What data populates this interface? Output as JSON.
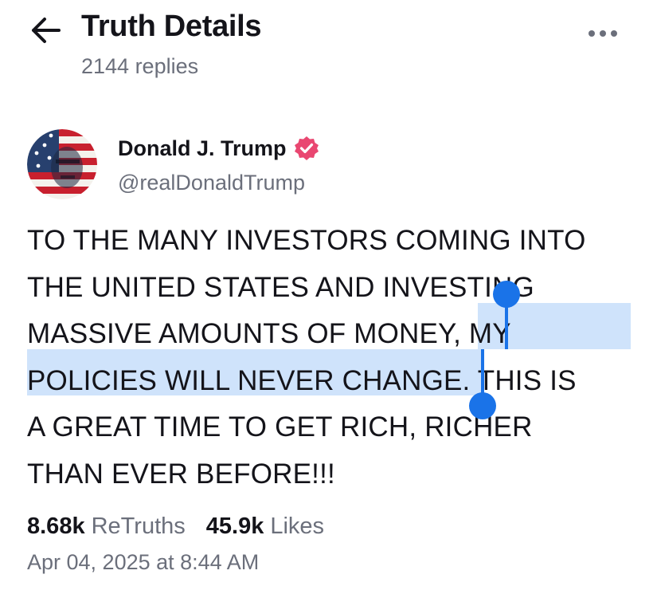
{
  "header": {
    "title": "Truth Details",
    "replies": "2144 replies",
    "back_icon": "arrow-left-icon",
    "more_icon": "more-horizontal-icon"
  },
  "post": {
    "author": {
      "name": "Donald J. Trump",
      "handle": "@realDonaldTrump",
      "verified_icon": "verified-badge-icon",
      "verified_color": "#e94771"
    },
    "lines": [
      "TO THE MANY INVESTORS COMING INTO",
      "THE UNITED STATES AND INVESTING",
      "MASSIVE AMOUNTS OF MONEY, MY",
      "POLICIES WILL NEVER CHANGE. THIS IS",
      "A GREAT TIME TO GET RICH, RICHER",
      "THAN EVER BEFORE!!!"
    ],
    "selected_text": "MY POLICIES WILL NEVER CHANGE",
    "stats": {
      "retruths_count": "8.68k",
      "retruths_label": "ReTruths",
      "likes_count": "45.9k",
      "likes_label": "Likes"
    },
    "timestamp": "Apr 04, 2025 at 8:44 AM"
  },
  "colors": {
    "selection_highlight": "#cfe3fb",
    "selection_handle": "#1a73e8",
    "muted_text": "#6b6f7b"
  }
}
